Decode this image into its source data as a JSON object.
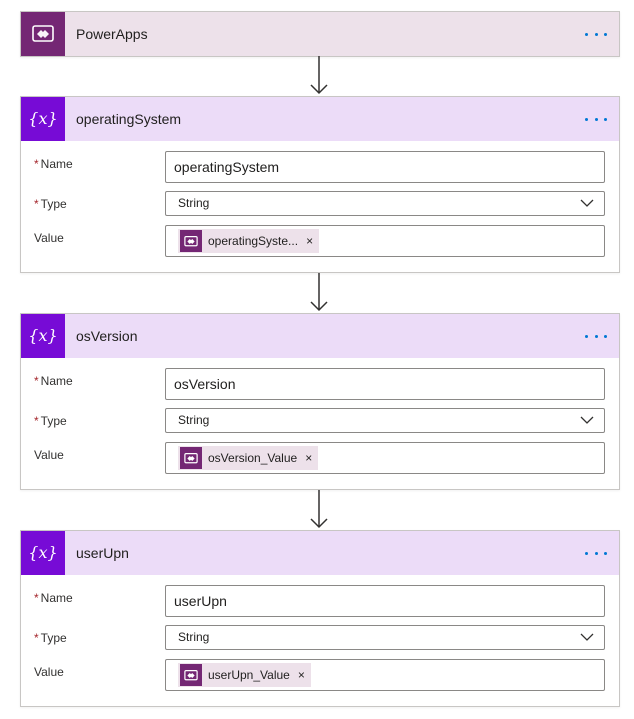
{
  "trigger": {
    "title": "PowerApps",
    "icon": "powerapps-icon",
    "more_icon": "more-options-icon",
    "header_color": "#ede1ea",
    "icon_color": "#742774"
  },
  "labels": {
    "name": "Name",
    "type": "Type",
    "value": "Value",
    "required_mark": "*",
    "remove_token": "×"
  },
  "actions": [
    {
      "title": "operatingSystem",
      "name_value": "operatingSystem",
      "type_value": "String",
      "token_label": "operatingSyste..."
    },
    {
      "title": "osVersion",
      "name_value": "osVersion",
      "type_value": "String",
      "token_label": "osVersion_Value"
    },
    {
      "title": "userUpn",
      "name_value": "userUpn",
      "type_value": "String",
      "token_label": "userUpn_Value"
    }
  ],
  "colors": {
    "variable_header": "#ecdcf8",
    "variable_icon": "#770bd6",
    "more_dots": "#0078d4",
    "required": "#a4262c"
  }
}
